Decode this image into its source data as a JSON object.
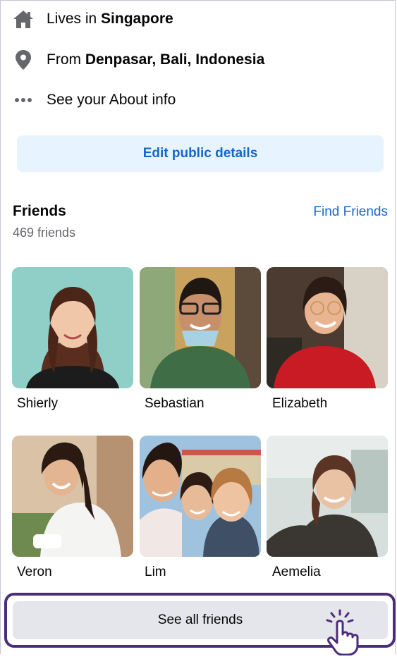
{
  "intro": {
    "lives_prefix": "Lives in ",
    "lives_place": "Singapore",
    "from_prefix": "From ",
    "from_place": "Denpasar, Bali, Indonesia",
    "about_label": "See your About info",
    "edit_button": "Edit public details"
  },
  "friends": {
    "title": "Friends",
    "count": "469 friends",
    "find_friends": "Find Friends",
    "see_all": "See all friends",
    "items": [
      {
        "name": "Shierly"
      },
      {
        "name": "Sebastian"
      },
      {
        "name": "Elizabeth"
      },
      {
        "name": "Veron"
      },
      {
        "name": "Lim"
      },
      {
        "name": "Aemelia"
      }
    ]
  },
  "colors": {
    "link_blue": "#1467c8",
    "light_blue_button": "#e7f3ff",
    "grey_button": "#e4e6eb",
    "highlight_purple": "#4b2c7a",
    "icon_grey": "#65676b"
  },
  "icons": [
    "home-icon",
    "location-pin-icon",
    "more-dots-icon",
    "tap-hand-icon"
  ]
}
